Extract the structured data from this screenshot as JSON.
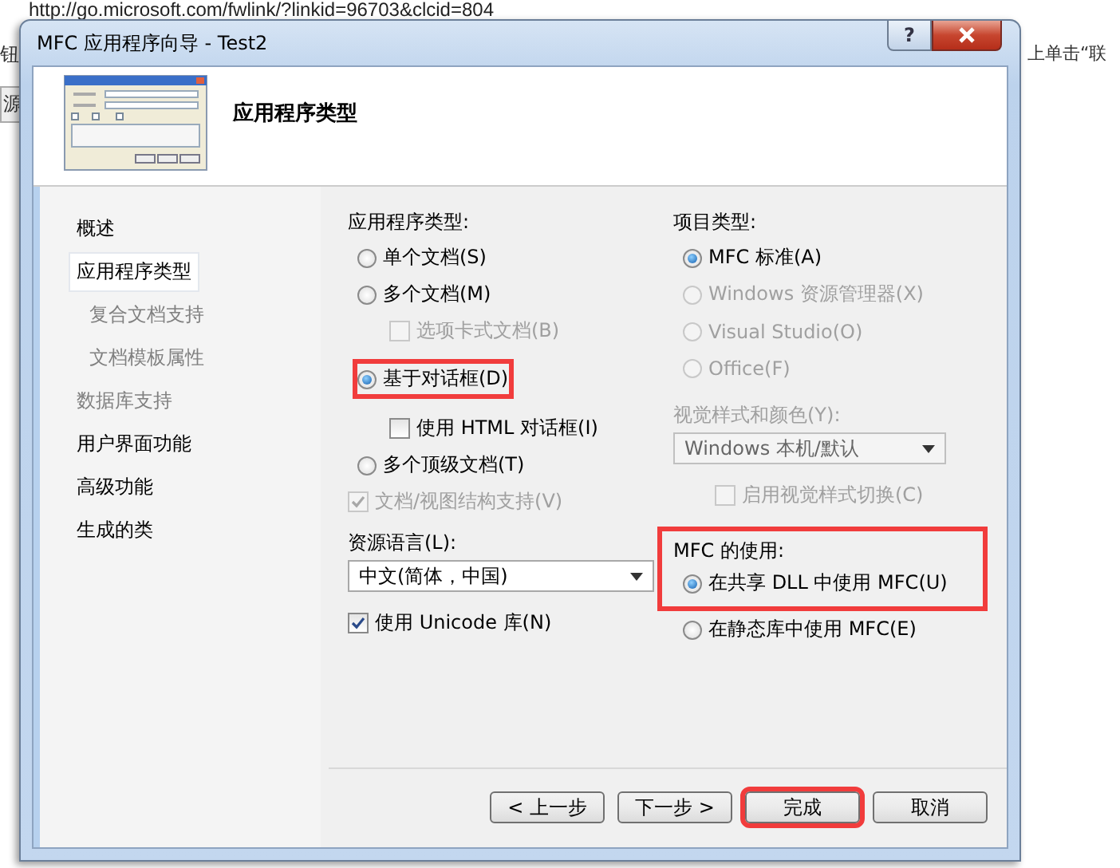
{
  "browser": {
    "url": "http://go.microsoft.com/fwlink/?linkid=96703&clcid=804",
    "left_texts": [
      "钮",
      "源"
    ],
    "right_text": "上单击“联"
  },
  "window": {
    "title": "MFC 应用程序向导 - Test2",
    "help": "?"
  },
  "header": {
    "title": "应用程序类型"
  },
  "sidebar": {
    "items": [
      {
        "label": "概述",
        "selected": false,
        "disabled": false
      },
      {
        "label": "应用程序类型",
        "selected": true,
        "disabled": false,
        "children": [
          {
            "label": "复合文档支持",
            "selected": false,
            "disabled": true
          },
          {
            "label": "文档模板属性",
            "selected": false,
            "disabled": true
          }
        ]
      },
      {
        "label": "数据库支持",
        "selected": false,
        "disabled": true
      },
      {
        "label": "用户界面功能",
        "selected": false,
        "disabled": false
      },
      {
        "label": "高级功能",
        "selected": false,
        "disabled": false
      },
      {
        "label": "生成的类",
        "selected": false,
        "disabled": false
      }
    ]
  },
  "application_type": {
    "label": "应用程序类型:",
    "options": [
      {
        "kind": "radio",
        "label": "单个文档(S)",
        "selected": false,
        "disabled": false,
        "highlighted": false
      },
      {
        "kind": "radio",
        "label": "多个文档(M)",
        "selected": false,
        "disabled": false,
        "highlighted": false,
        "children": [
          {
            "kind": "checkbox",
            "label": "选项卡式文档(B)",
            "checked": false,
            "disabled": true,
            "highlighted": false
          }
        ]
      },
      {
        "kind": "radio",
        "label": "基于对话框(D)",
        "selected": true,
        "disabled": false,
        "highlighted": true,
        "children": [
          {
            "kind": "checkbox",
            "label": "使用 HTML 对话框(I)",
            "checked": false,
            "disabled": false,
            "highlighted": false
          }
        ]
      },
      {
        "kind": "radio",
        "label": "多个顶级文档(T)",
        "selected": false,
        "disabled": false,
        "highlighted": false
      },
      {
        "kind": "checkbox",
        "label": "文档/视图结构支持(V)",
        "checked": true,
        "disabled": true,
        "highlighted": false
      }
    ]
  },
  "resource_language": {
    "label": "资源语言(L):",
    "value": "中文(简体，中国)",
    "disabled": false
  },
  "unicode": {
    "kind": "checkbox",
    "label": "使用 Unicode 库(N)",
    "checked": true,
    "disabled": false,
    "highlighted": false
  },
  "project_type": {
    "label": "项目类型:",
    "options": [
      {
        "kind": "radio",
        "label": "MFC 标准(A)",
        "selected": true,
        "disabled": false,
        "highlighted": false
      },
      {
        "kind": "radio",
        "label": "Windows 资源管理器(X)",
        "selected": false,
        "disabled": true,
        "highlighted": false
      },
      {
        "kind": "radio",
        "label": "Visual Studio(O)",
        "selected": false,
        "disabled": true,
        "highlighted": false
      },
      {
        "kind": "radio",
        "label": "Office(F)",
        "selected": false,
        "disabled": true,
        "highlighted": false
      }
    ]
  },
  "visual_style": {
    "label": "视觉样式和颜色(Y):",
    "value": "Windows 本机/默认",
    "disabled": true,
    "toggle": {
      "kind": "checkbox",
      "label": "启用视觉样式切换(C)",
      "checked": false,
      "disabled": true,
      "highlighted": false
    }
  },
  "mfc_use": {
    "label": "MFC 的使用:",
    "options": [
      {
        "kind": "radio",
        "label": "在共享 DLL 中使用 MFC(U)",
        "selected": true,
        "disabled": false,
        "highlighted": true
      },
      {
        "kind": "radio",
        "label": "在静态库中使用 MFC(E)",
        "selected": false,
        "disabled": false,
        "highlighted": false
      }
    ]
  },
  "buttons": [
    {
      "label": "< 上一步",
      "highlighted": false
    },
    {
      "label": "下一步 >",
      "highlighted": false
    },
    {
      "label": "完成",
      "highlighted": true
    },
    {
      "label": "取消",
      "highlighted": false
    }
  ]
}
